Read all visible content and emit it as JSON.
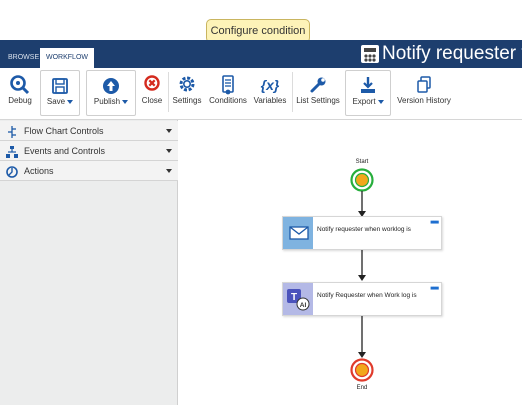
{
  "tooltip": {
    "text": "Configure condition"
  },
  "tabs": {
    "browse": "BROWSE",
    "workflow": "WORKFLOW"
  },
  "title": {
    "text": "Notify requester v"
  },
  "ribbon": {
    "debug": "Debug",
    "save": "Save",
    "publish": "Publish",
    "close": "Close",
    "settings": "Settings",
    "conditions": "Conditions",
    "variables": "Variables",
    "variables_glyph": "{x}",
    "list_settings": "List Settings",
    "export": "Export",
    "version_history": "Version History"
  },
  "left_panel": {
    "items": [
      {
        "label": "Flow Chart Controls",
        "icon": "flowchart-icon"
      },
      {
        "label": "Events and Controls",
        "icon": "events-icon"
      },
      {
        "label": "Actions",
        "icon": "actions-icon"
      }
    ]
  },
  "canvas": {
    "start_label": "Start",
    "end_label": "End",
    "actions": [
      {
        "text": "Notify requester when worklog is",
        "icon": "email-icon"
      },
      {
        "text": "Notify Requester when Work log is",
        "icon": "teams-ai-icon"
      }
    ]
  },
  "colors": {
    "title_bar": "#1d3e6e",
    "accent_blue": "#1e6fd0",
    "start_green": "#27ae3c",
    "end_red": "#e03b2c"
  }
}
